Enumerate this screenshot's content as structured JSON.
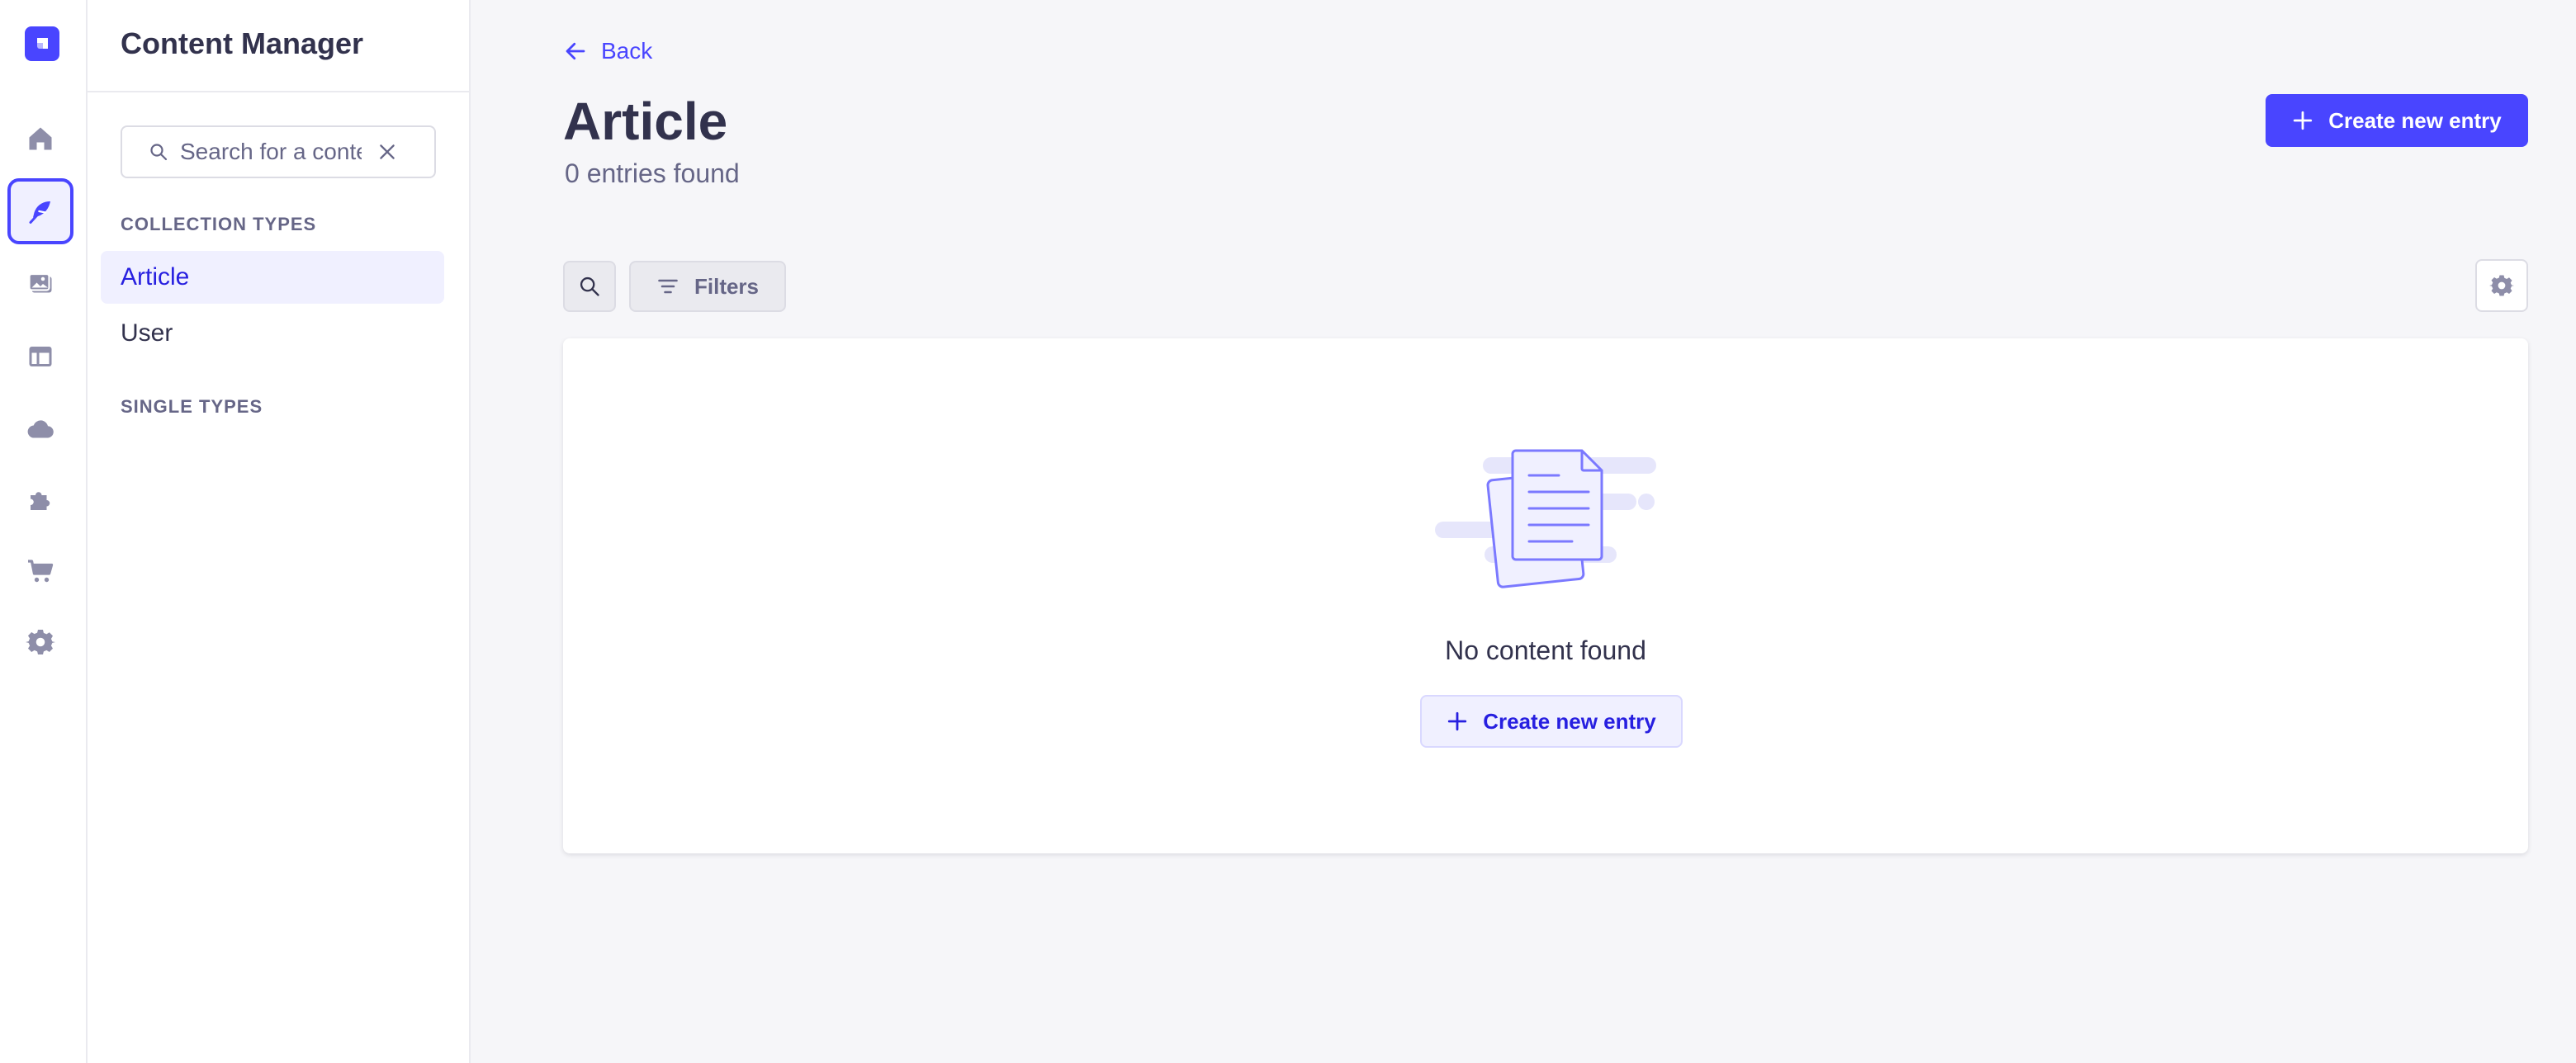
{
  "rail": {
    "items": [
      {
        "name": "home-icon"
      },
      {
        "name": "content-manager-icon",
        "active": true
      },
      {
        "name": "media-library-icon"
      },
      {
        "name": "content-type-builder-icon"
      },
      {
        "name": "cloud-icon"
      },
      {
        "name": "plugins-icon"
      },
      {
        "name": "marketplace-cart-icon"
      },
      {
        "name": "settings-gear-icon"
      }
    ]
  },
  "subnav": {
    "title": "Content Manager",
    "search_placeholder": "Search for a content type",
    "collection_types_label": "COLLECTION TYPES",
    "collection_types": [
      {
        "label": "Article",
        "active": true
      },
      {
        "label": "User",
        "active": false
      }
    ],
    "single_types_label": "SINGLE TYPES"
  },
  "main": {
    "back_label": "Back",
    "title": "Article",
    "subtitle": "0 entries found",
    "create_button_label": "Create new entry",
    "filters_label": "Filters",
    "empty_state": {
      "message": "No content found",
      "button_label": "Create new entry"
    }
  },
  "colors": {
    "primary": "#4945ff",
    "primary_light": "#f0f0ff",
    "neutral_text": "#32324d",
    "muted_text": "#666687",
    "background": "#f6f6f9"
  }
}
